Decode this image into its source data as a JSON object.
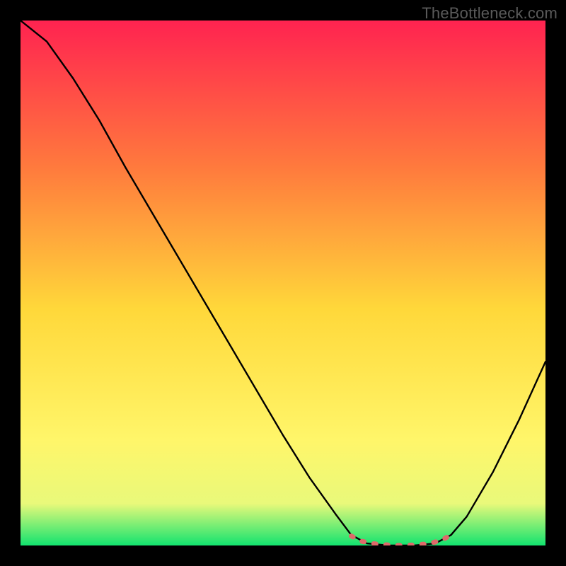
{
  "watermark": "TheBottleneck.com",
  "chart_data": {
    "type": "line",
    "title": "",
    "xlabel": "",
    "ylabel": "",
    "xlim": [
      0,
      100
    ],
    "ylim": [
      0,
      100
    ],
    "grid": false,
    "background_gradient": {
      "top": "#ff2350",
      "mid1": "#ff7a3d",
      "mid2": "#ffd83a",
      "mid3": "#fff66a",
      "bottom": "#12e36f"
    },
    "curve": [
      {
        "x": 0,
        "y": 100
      },
      {
        "x": 5,
        "y": 96
      },
      {
        "x": 10,
        "y": 89
      },
      {
        "x": 15,
        "y": 81
      },
      {
        "x": 20,
        "y": 72
      },
      {
        "x": 25,
        "y": 63.5
      },
      {
        "x": 30,
        "y": 55
      },
      {
        "x": 35,
        "y": 46.5
      },
      {
        "x": 40,
        "y": 38
      },
      {
        "x": 45,
        "y": 29.5
      },
      {
        "x": 50,
        "y": 21
      },
      {
        "x": 55,
        "y": 13
      },
      {
        "x": 60,
        "y": 6
      },
      {
        "x": 63,
        "y": 2
      },
      {
        "x": 66,
        "y": 0.4
      },
      {
        "x": 70,
        "y": 0
      },
      {
        "x": 75,
        "y": 0
      },
      {
        "x": 79,
        "y": 0.4
      },
      {
        "x": 82,
        "y": 2
      },
      {
        "x": 85,
        "y": 5.5
      },
      {
        "x": 90,
        "y": 14
      },
      {
        "x": 95,
        "y": 24
      },
      {
        "x": 100,
        "y": 35
      }
    ],
    "trough_marker": {
      "x_start": 63,
      "x_end": 82,
      "color": "#dd6a6a",
      "points": [
        {
          "x": 63,
          "y": 1.8
        },
        {
          "x": 65,
          "y": 0.8
        },
        {
          "x": 67.5,
          "y": 0.3
        },
        {
          "x": 70,
          "y": 0.1
        },
        {
          "x": 72.5,
          "y": 0.0
        },
        {
          "x": 75,
          "y": 0.1
        },
        {
          "x": 77.5,
          "y": 0.3
        },
        {
          "x": 80,
          "y": 0.9
        },
        {
          "x": 82,
          "y": 2.0
        }
      ]
    }
  }
}
